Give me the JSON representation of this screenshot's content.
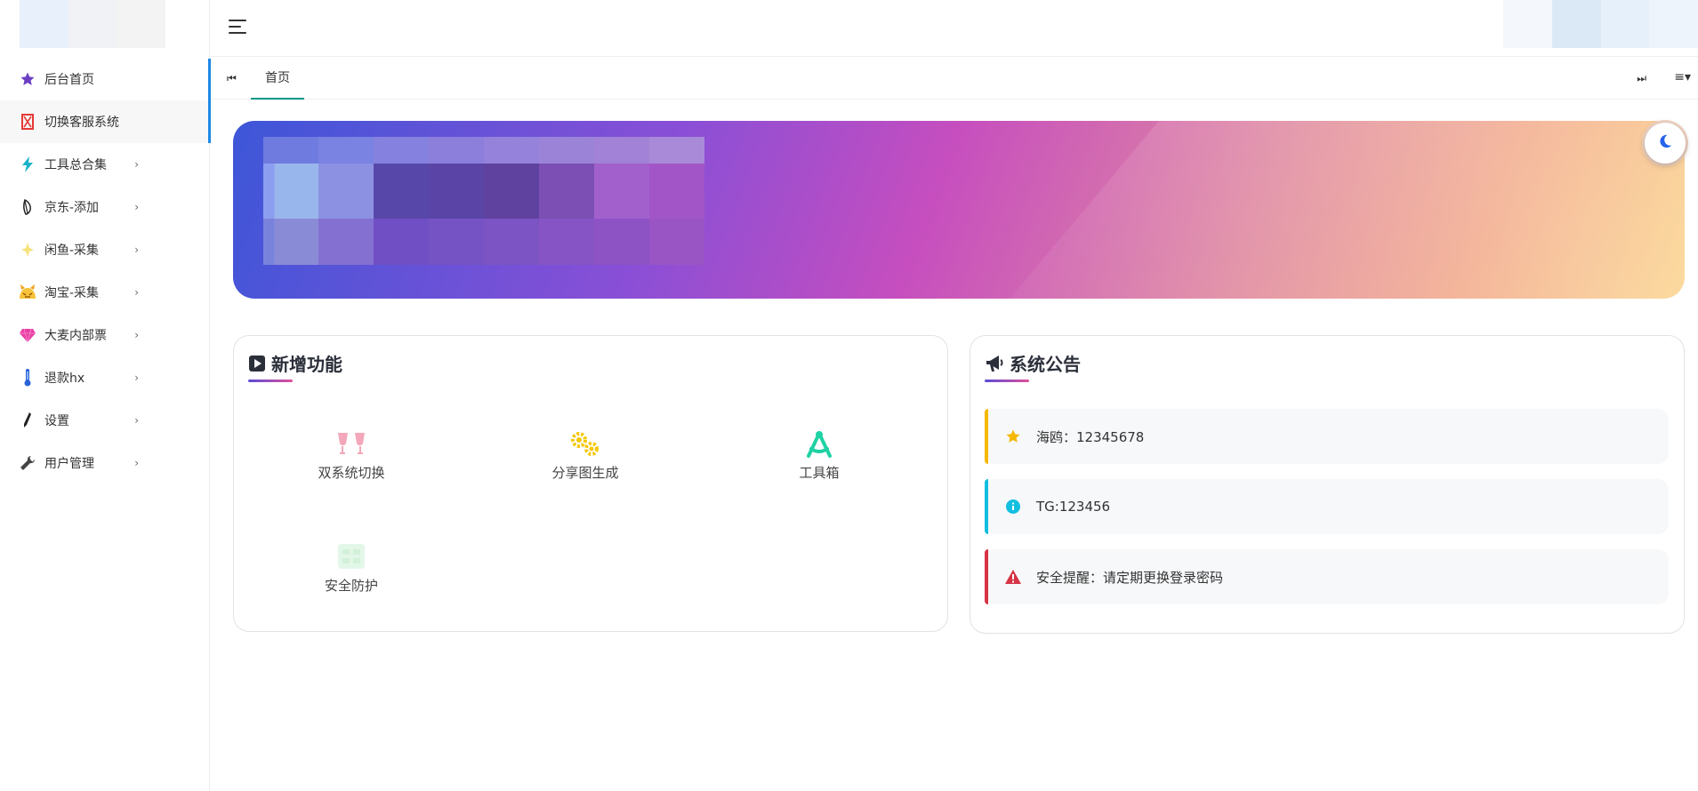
{
  "sidebar": {
    "logo_colors": [
      "#e8f1fb",
      "#f0f2f5",
      "#f3f3f3"
    ],
    "items": [
      {
        "label": "后台首页",
        "icon": "star-icon",
        "color": "#6c3fc2",
        "arrow": false
      },
      {
        "label": "切换客服系统",
        "icon": "x-box-icon",
        "color": "#e53935",
        "arrow": false
      },
      {
        "label": "工具总合集",
        "icon": "lightning-icon",
        "color": "#19b3c9",
        "arrow": true
      },
      {
        "label": "京东-添加",
        "icon": "leaf-icon",
        "color": "#222222",
        "arrow": true
      },
      {
        "label": "闲鱼-采集",
        "icon": "sparkle-icon",
        "color": "#f7e27a",
        "arrow": true
      },
      {
        "label": "淘宝-采集",
        "icon": "cat-face-icon",
        "color": "#f0a21a",
        "arrow": true
      },
      {
        "label": "大麦内部票",
        "icon": "gem-icon",
        "color": "#ea3fa6",
        "arrow": true
      },
      {
        "label": "退款hx",
        "icon": "thermometer-icon",
        "color": "#2a63d8",
        "arrow": true
      },
      {
        "label": "设置",
        "icon": "pen-icon",
        "color": "#222222",
        "arrow": true
      },
      {
        "label": "用户管理",
        "icon": "wrench-icon",
        "color": "#444444",
        "arrow": true
      }
    ],
    "arrow_glyph": "›"
  },
  "header": {
    "menu_icon": "hamburger-icon",
    "avatar_colors": [
      "#f4f8fc",
      "#dbe9f6",
      "#e6f0fa",
      "#eef4fb"
    ]
  },
  "tabs": {
    "prev_glyph": "⏮",
    "home_label": "首页",
    "next_glyph": "⏭",
    "menu_glyph": "≡▾"
  },
  "features": {
    "title": "新增功能",
    "items": [
      {
        "label": "双系统切换",
        "icon": "toast-glasses-icon",
        "color": "#f4a7b9"
      },
      {
        "label": "分享图生成",
        "icon": "gears-icon",
        "color": "#f5c800"
      },
      {
        "label": "工具箱",
        "icon": "compass-icon",
        "color": "#1fd1a4"
      },
      {
        "label": "安全防护",
        "icon": "shield-pattern-icon",
        "color": "#e3f7e8"
      }
    ]
  },
  "notice": {
    "title": "系统公告",
    "items": [
      {
        "text": "海鸥：12345678",
        "icon": "star-icon",
        "color": "#f5b800"
      },
      {
        "text": "TG:123456",
        "icon": "info-icon",
        "color": "#13bfe0"
      },
      {
        "text": "安全提醒：请定期更换登录密码",
        "icon": "warning-icon",
        "color": "#d63344"
      }
    ]
  }
}
